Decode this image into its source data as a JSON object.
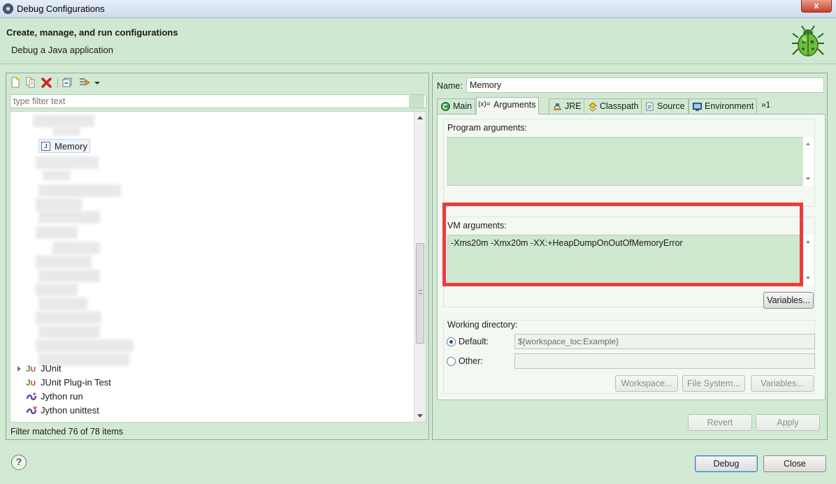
{
  "window": {
    "title": "Debug Configurations",
    "close_label": "x"
  },
  "header": {
    "title": "Create, manage, and run configurations",
    "subtitle": "Debug a Java application"
  },
  "left": {
    "filter_placeholder": "type filter text",
    "selected_item": "Memory",
    "items": [
      {
        "label": "JUnit",
        "icon": "junit-icon"
      },
      {
        "label": "JUnit Plug-in Test",
        "icon": "junit-plugin-icon"
      },
      {
        "label": "Jython run",
        "icon": "jython-icon"
      },
      {
        "label": "Jython unittest",
        "icon": "jython-unittest-icon"
      }
    ],
    "status": "Filter matched 76 of 78 items"
  },
  "right": {
    "name_label": "Name:",
    "name_value": "Memory",
    "tabs": [
      {
        "label": "Main",
        "icon": "main-tab-icon"
      },
      {
        "label": "Arguments",
        "icon": "arguments-tab-icon",
        "active": true
      },
      {
        "label": "JRE",
        "icon": "jre-tab-icon"
      },
      {
        "label": "Classpath",
        "icon": "classpath-tab-icon"
      },
      {
        "label": "Source",
        "icon": "source-tab-icon"
      },
      {
        "label": "Environment",
        "icon": "environment-tab-icon"
      }
    ],
    "tabs_more": "»1",
    "program_args_label": "Program arguments:",
    "program_args_value": "",
    "vm_args_label": "VM arguments:",
    "vm_args_value": "-Xms20m -Xmx20m -XX:+HeapDumpOnOutOfMemoryError",
    "variables_label": "Variables...",
    "working_dir_label": "Working directory:",
    "default_label": "Default:",
    "default_value": "${workspace_loc:Example}",
    "other_label": "Other:",
    "other_value": "",
    "workspace_label": "Workspace...",
    "filesystem_label": "File System...",
    "revert_label": "Revert",
    "apply_label": "Apply"
  },
  "footer": {
    "help_label": "?",
    "debug_label": "Debug",
    "close_label": "Close"
  },
  "colors": {
    "accent_green": "#d2ead4",
    "highlight_red": "#ee3a3a"
  }
}
